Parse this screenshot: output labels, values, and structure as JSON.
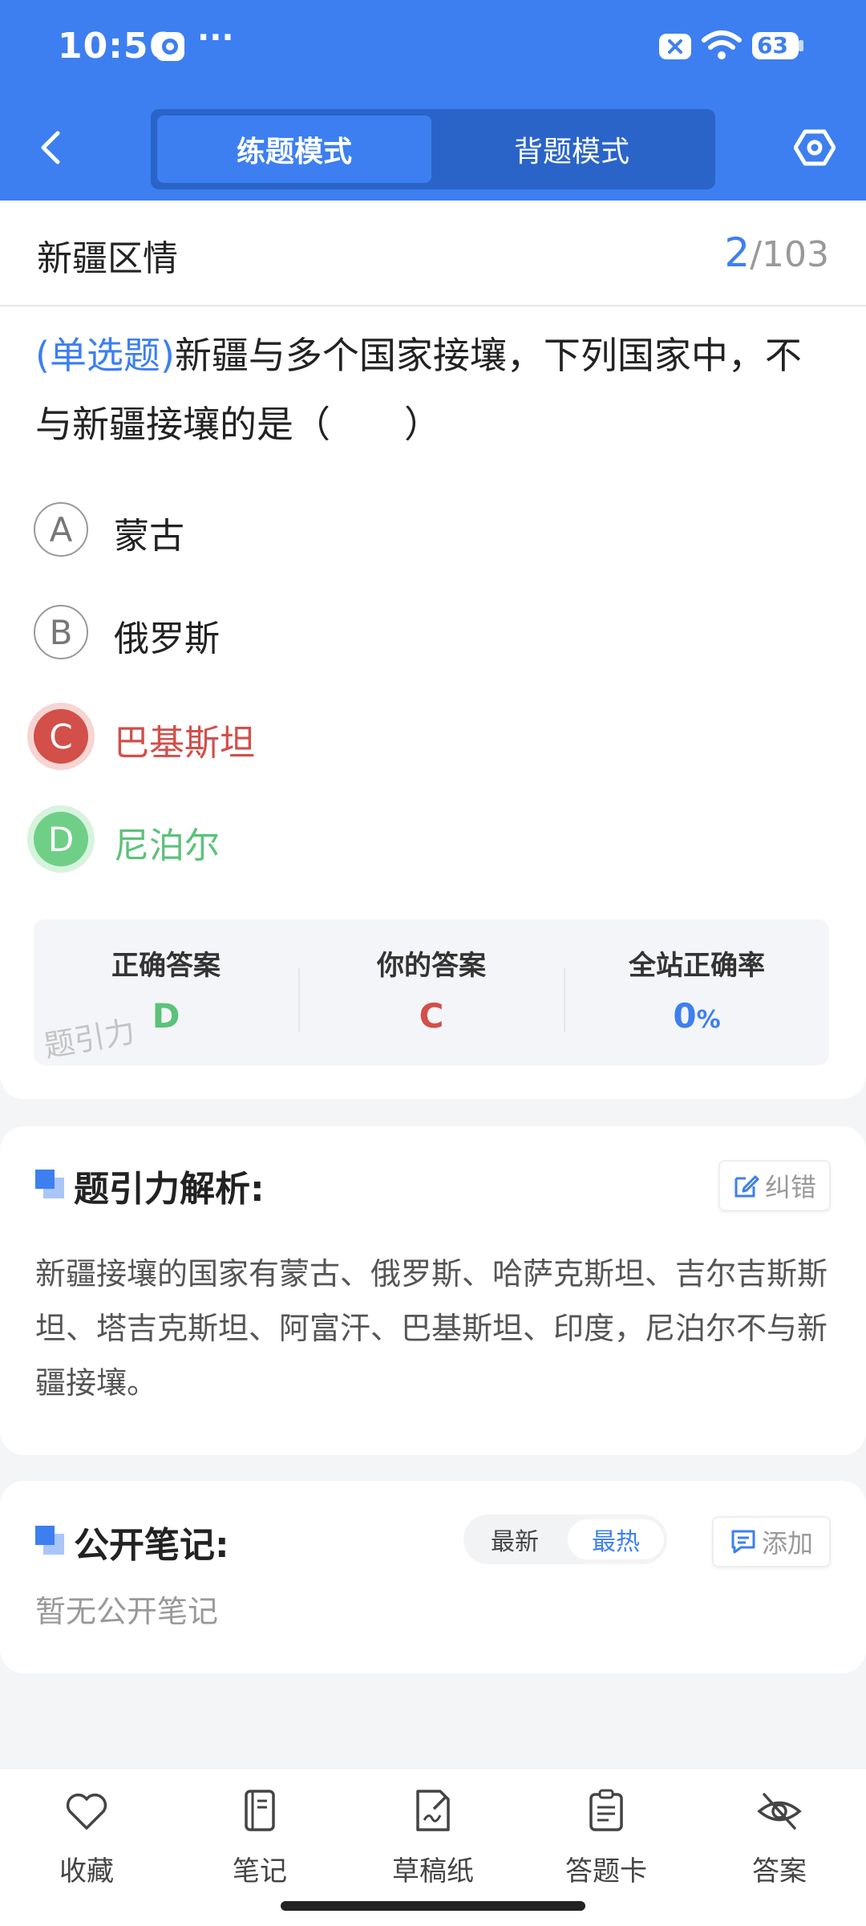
{
  "status_bar": {
    "time": "10:56",
    "battery": "63"
  },
  "header": {
    "modes": [
      "练题模式",
      "背题模式"
    ],
    "active_mode": "练题模式"
  },
  "quiz": {
    "category": "新疆区情",
    "current": "2",
    "total": "/103",
    "question_type": "(单选题)",
    "question_text": "新疆与多个国家接壤，下列国家中，不与新疆接壤的是（　　）",
    "options": [
      {
        "letter": "A",
        "text": "蒙古",
        "state": "normal"
      },
      {
        "letter": "B",
        "text": "俄罗斯",
        "state": "normal"
      },
      {
        "letter": "C",
        "text": "巴基斯坦",
        "state": "wrong"
      },
      {
        "letter": "D",
        "text": "尼泊尔",
        "state": "correct"
      }
    ]
  },
  "answer_summary": {
    "correct_label": "正确答案",
    "correct_value": "D",
    "yours_label": "你的答案",
    "yours_value": "C",
    "rate_label": "全站正确率",
    "rate_value": "0",
    "rate_unit": "%",
    "watermark": "题引力"
  },
  "analysis": {
    "title": "题引力解析:",
    "correct_button": "纠错",
    "text": "新疆接壤的国家有蒙古、俄罗斯、哈萨克斯坦、吉尔吉斯斯坦、塔吉克斯坦、阿富汗、巴基斯坦、印度，尼泊尔不与新疆接壤。"
  },
  "notes": {
    "title": "公开笔记:",
    "sort_options": [
      "最新",
      "最热"
    ],
    "active_sort": "最热",
    "add_button": "添加",
    "empty_text": "暂无公开笔记"
  },
  "bottom_bar": [
    {
      "label": "收藏",
      "icon": "heart-icon"
    },
    {
      "label": "笔记",
      "icon": "notebook-icon"
    },
    {
      "label": "草稿纸",
      "icon": "draft-paper-icon"
    },
    {
      "label": "答题卡",
      "icon": "answer-card-icon"
    },
    {
      "label": "答案",
      "icon": "eye-off-icon"
    }
  ],
  "colors": {
    "primary": "#3d7ff0",
    "wrong": "#d24f4a",
    "correct": "#5bc27a"
  }
}
